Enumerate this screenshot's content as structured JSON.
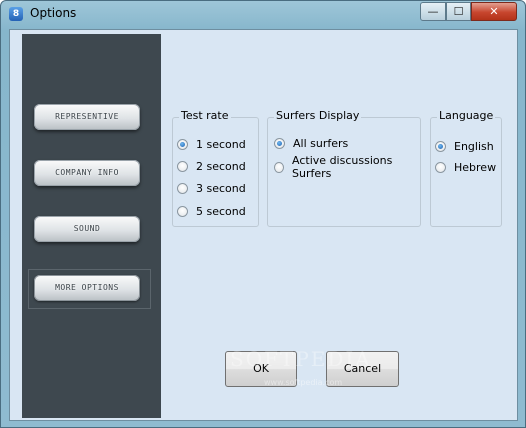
{
  "window": {
    "title": "Options",
    "app_icon": "app-icon",
    "minimize_glyph": "—",
    "maximize_glyph": "☐",
    "close_glyph": "✕"
  },
  "sidebar": {
    "items": [
      {
        "label": "REPRESENTIVE",
        "selected": false
      },
      {
        "label": "COMPANY INFO",
        "selected": false
      },
      {
        "label": "SOUND",
        "selected": false
      },
      {
        "label": "MORE OPTIONS",
        "selected": true
      }
    ]
  },
  "test_rate": {
    "title": "Test rate",
    "options": [
      {
        "label": "1 second",
        "checked": true
      },
      {
        "label": "2 second",
        "checked": false
      },
      {
        "label": "3 second",
        "checked": false
      },
      {
        "label": "5 second",
        "checked": false
      }
    ]
  },
  "surfers_display": {
    "title": "Surfers Display",
    "options": [
      {
        "label": "All surfers",
        "checked": true
      },
      {
        "label": "Active discussions Surfers",
        "checked": false
      }
    ]
  },
  "language": {
    "title": "Language",
    "options": [
      {
        "label": "English",
        "checked": true
      },
      {
        "label": "Hebrew",
        "checked": false
      }
    ]
  },
  "buttons": {
    "ok": "OK",
    "cancel": "Cancel"
  },
  "watermark": {
    "text": "SOFTPEDIA",
    "url": "www.softpedia.com"
  },
  "colors": {
    "sidebar_bg": "#3e484f",
    "client_bg": "#d9e6f3",
    "close_button": "#c7462e"
  }
}
